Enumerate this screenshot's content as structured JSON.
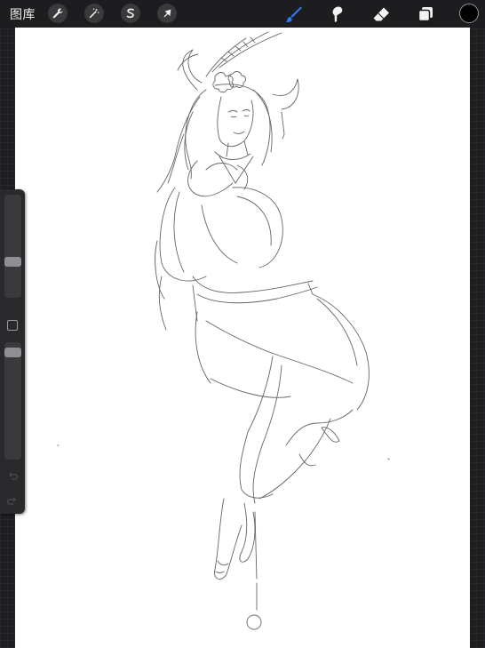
{
  "app": {
    "gallery_label": "图库"
  },
  "toolbar": {
    "left_tools": [
      {
        "icon": "wrench-icon",
        "name": "actions"
      },
      {
        "icon": "magic-wand-icon",
        "name": "adjustments"
      },
      {
        "icon": "selection-s-icon",
        "name": "selection"
      },
      {
        "icon": "arrow-cursor-icon",
        "name": "transform"
      }
    ],
    "right_tools": [
      {
        "icon": "brush-icon",
        "name": "paint",
        "active": true
      },
      {
        "icon": "smudge-icon",
        "name": "smudge"
      },
      {
        "icon": "eraser-icon",
        "name": "erase"
      },
      {
        "icon": "layers-icon",
        "name": "layers"
      }
    ],
    "current_color": "#000000",
    "active_tool_color": "#2f7cf6"
  },
  "sidebar": {
    "brush_size_level": 0.33,
    "opacity_level": 0.95,
    "modify_button_icon": "square-icon",
    "undo_icon": "undo-icon",
    "redo_icon": "redo-icon"
  }
}
